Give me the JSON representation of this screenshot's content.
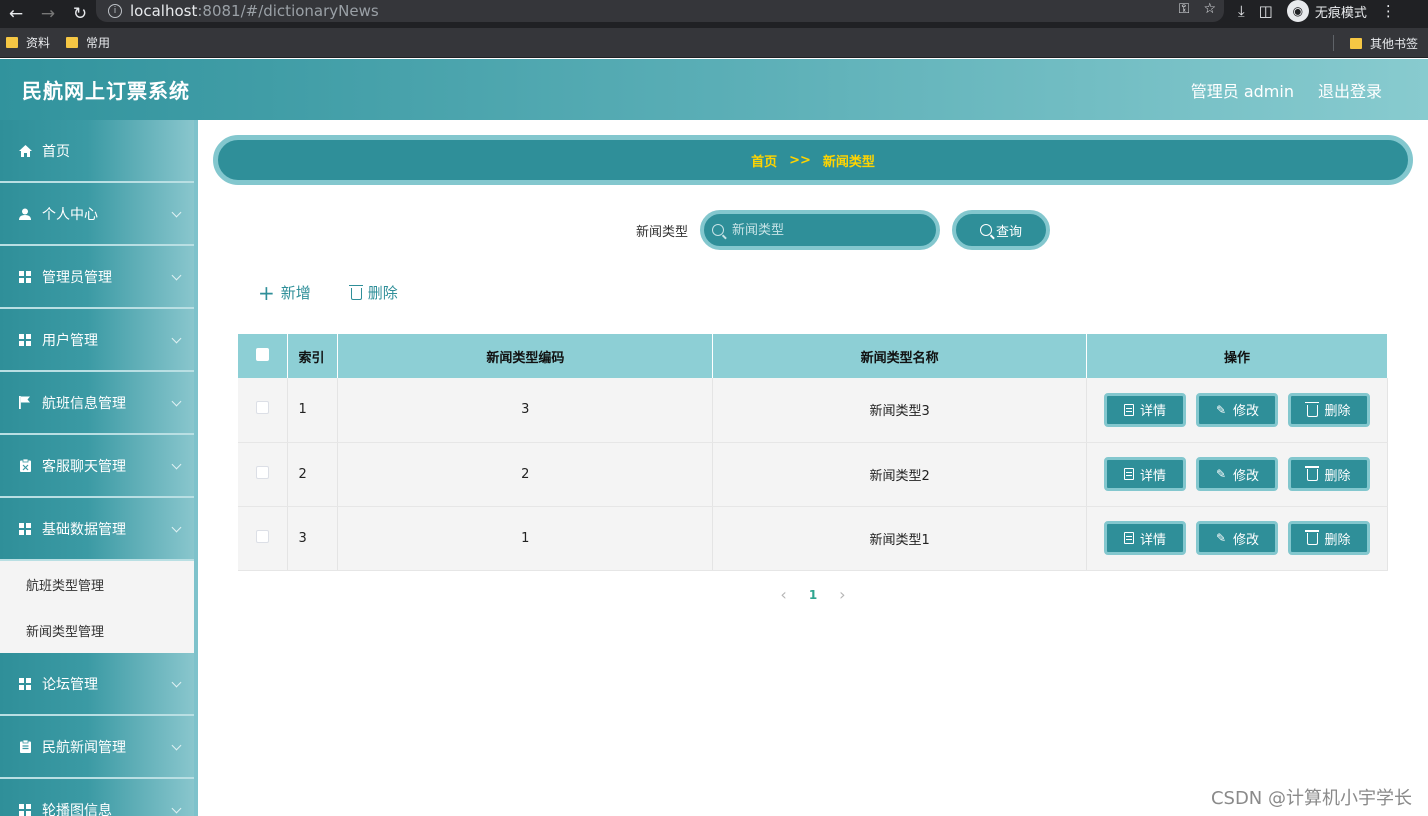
{
  "browser": {
    "url_host": "localhost",
    "url_rest": ":8081/#/dictionaryNews",
    "incognito_label": "无痕模式",
    "bookmarks": [
      "资料",
      "常用"
    ],
    "other_bookmarks": "其他书签"
  },
  "header": {
    "title": "民航网上订票系统",
    "user_label": "管理员 admin",
    "logout_label": "退出登录"
  },
  "sidebar": {
    "items": [
      {
        "label": "首页",
        "icon": "home-icon"
      },
      {
        "label": "个人中心",
        "icon": "user-icon"
      },
      {
        "label": "管理员管理",
        "icon": "grid-icon"
      },
      {
        "label": "用户管理",
        "icon": "grid-icon"
      },
      {
        "label": "航班信息管理",
        "icon": "flag-icon"
      },
      {
        "label": "客服聊天管理",
        "icon": "clipboard-icon"
      },
      {
        "label": "基础数据管理",
        "icon": "grid-icon"
      }
    ],
    "sub_items": [
      "航班类型管理",
      "新闻类型管理"
    ],
    "items_after": [
      {
        "label": "论坛管理",
        "icon": "grid-icon"
      },
      {
        "label": "民航新闻管理",
        "icon": "clipboard-icon"
      },
      {
        "label": "轮播图信息",
        "icon": "grid-icon"
      }
    ]
  },
  "breadcrumb": {
    "home": "首页",
    "separator": ">>",
    "current": "新闻类型"
  },
  "search": {
    "label": "新闻类型",
    "placeholder": "新闻类型",
    "button": "查询"
  },
  "actions": {
    "add": "新增",
    "delete": "删除"
  },
  "table": {
    "headers": [
      "索引",
      "新闻类型编码",
      "新闻类型名称",
      "操作"
    ],
    "rows": [
      {
        "index": "1",
        "code": "3",
        "name": "新闻类型3"
      },
      {
        "index": "2",
        "code": "2",
        "name": "新闻类型2"
      },
      {
        "index": "3",
        "code": "1",
        "name": "新闻类型1"
      }
    ],
    "row_actions": {
      "detail": "详情",
      "edit": "修改",
      "delete": "删除"
    }
  },
  "pagination": {
    "current_page": "1"
  },
  "watermark": "CSDN @计算机小宇学长"
}
